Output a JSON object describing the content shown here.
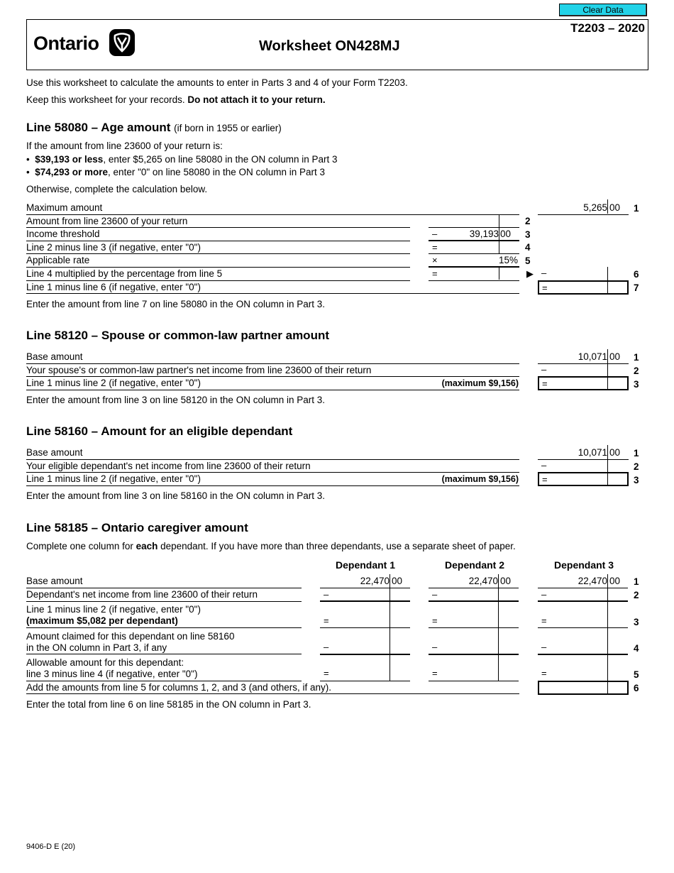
{
  "toolbar": {
    "clear_label": "Clear Data"
  },
  "header": {
    "logo_text": "Ontario",
    "title": "Worksheet ON428MJ",
    "form_id": "T2203 – 2020"
  },
  "intro": {
    "line1": "Use this worksheet to calculate the amounts to enter in Parts 3 and 4 of your Form T2203.",
    "line2_normal": "Keep this worksheet for your records. ",
    "line2_bold": "Do not attach it to your return."
  },
  "age": {
    "heading": "Line 58080 – Age amount",
    "heading_note": "(if born in 1955 or earlier)",
    "cond": "If the amount from line 23600 of your return is:",
    "b1_bold": "$39,193 or less",
    "b1_rest": ", enter $5,265 on line 58080 in the ON column in Part 3",
    "b2_bold": "$74,293 or more",
    "b2_rest": ", enter \"0\" on line 58080 in the ON column in Part 3",
    "otherwise": "Otherwise, complete the calculation below.",
    "rows": [
      {
        "label": "Maximum amount",
        "num": "1",
        "dollars": "5,265",
        "cents": "00"
      },
      {
        "label": "Amount from line 23600 of your return",
        "num": "2"
      },
      {
        "label": "Income threshold",
        "num": "3",
        "sign": "–",
        "dollars": "39,193",
        "cents": "00"
      },
      {
        "label": "Line 2 minus line 3 (if negative, enter \"0\")",
        "num": "4",
        "sign": "="
      },
      {
        "label": "Applicable rate",
        "num": "5",
        "sign": "×",
        "rate": "15%"
      },
      {
        "label": "Line 4 multiplied by the percentage from line 5",
        "num": "6",
        "sign": "=",
        "sign2": "–",
        "arrow": "▶"
      },
      {
        "label": "Line 1 minus line 6 (if negative, enter \"0\")",
        "num": "7",
        "sign": "="
      }
    ],
    "note": "Enter the amount from line 7 on line 58080 in the ON column in Part 3."
  },
  "spouse": {
    "heading": "Line 58120 – Spouse or common-law partner amount",
    "rows": [
      {
        "label": "Base amount",
        "num": "1",
        "dollars": "10,071",
        "cents": "00"
      },
      {
        "label": "Your spouse's or common-law partner's net income from line 23600 of their return",
        "num": "2",
        "sign": "–"
      },
      {
        "label": "Line 1 minus line 2 (if negative, enter \"0\")",
        "num": "3",
        "sign": "=",
        "max": "(maximum $9,156)"
      }
    ],
    "note": "Enter the amount from line 3 on line 58120 in the ON column in Part 3."
  },
  "dependant": {
    "heading": "Line 58160 – Amount for an eligible dependant",
    "rows": [
      {
        "label": "Base amount",
        "num": "1",
        "dollars": "10,071",
        "cents": "00"
      },
      {
        "label": "Your eligible dependant's net income from line 23600 of their return",
        "num": "2",
        "sign": "–"
      },
      {
        "label": "Line 1 minus line 2 (if negative, enter \"0\")",
        "num": "3",
        "sign": "=",
        "max": "(maximum $9,156)"
      }
    ],
    "note": "Enter the amount from line 3 on line 58160 in the ON column in Part 3."
  },
  "caregiver": {
    "heading": "Line 58185 – Ontario caregiver amount",
    "intro_a": "Complete one column for ",
    "intro_b": "each",
    "intro_c": " dependant. If you have more than three dependants, use a separate sheet of paper.",
    "columns": [
      "Dependant 1",
      "Dependant 2",
      "Dependant 3"
    ],
    "base_dollars": "22,470",
    "base_cents": "00",
    "rows": [
      {
        "label": "Base amount",
        "num": "1"
      },
      {
        "label": "Dependant's net income from line 23600 of their return",
        "num": "2",
        "sign": "–"
      },
      {
        "label": "Line 1 minus line 2 (if negative, enter \"0\")",
        "label_bold": "(maximum $5,082 per dependant)",
        "num": "3",
        "sign": "="
      },
      {
        "label": "Amount claimed for this dependant on line 58160",
        "label2": "in the ON column in Part 3, if any",
        "num": "4",
        "sign": "–"
      },
      {
        "label": "Allowable amount for this dependant:",
        "label2": "line 3 minus line 4 (if negative, enter \"0\")",
        "num": "5",
        "sign": "="
      },
      {
        "label": "Add the amounts from line 5 for columns 1, 2, and 3 (and others, if any).",
        "num": "6"
      }
    ],
    "note": "Enter the total from line 6 on line 58185 in the ON column in Part 3."
  },
  "footer": {
    "code": "9406-D E (20)"
  }
}
